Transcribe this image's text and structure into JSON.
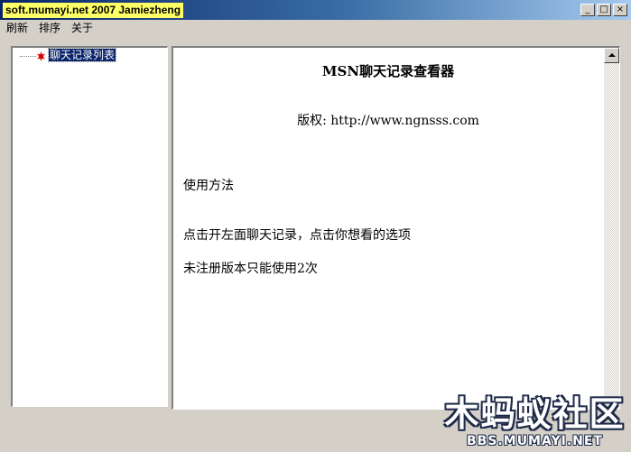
{
  "window": {
    "title": "soft.mumayi.net 2007  Jamiezheng",
    "buttons": {
      "minimize": "_",
      "maximize": "□",
      "close": "×"
    }
  },
  "menu": {
    "items": [
      {
        "label": "刷新"
      },
      {
        "label": "排序"
      },
      {
        "label": "关于"
      }
    ]
  },
  "tree": {
    "root": {
      "label": "聊天记录列表",
      "icon": "red-star-icon"
    }
  },
  "content": {
    "title": "MSN聊天记录查看器",
    "copyright": "版权: http://www.ngnsss.com",
    "usage_heading": "使用方法",
    "instruction": "点击开左面聊天记录，点击你想看的选项",
    "unregistered_notice": "未注册版本只能使用2次"
  },
  "watermark": {
    "text_cn": "木蚂蚁社区",
    "text_en": "BBS.MUMAYI.NET"
  },
  "colors": {
    "titlebar_start": "#0a246a",
    "titlebar_end": "#a6caf0",
    "title_highlight": "#ffff66",
    "selection": "#0a246a",
    "window_face": "#d4d0c8",
    "tree_icon": "#e00000"
  }
}
